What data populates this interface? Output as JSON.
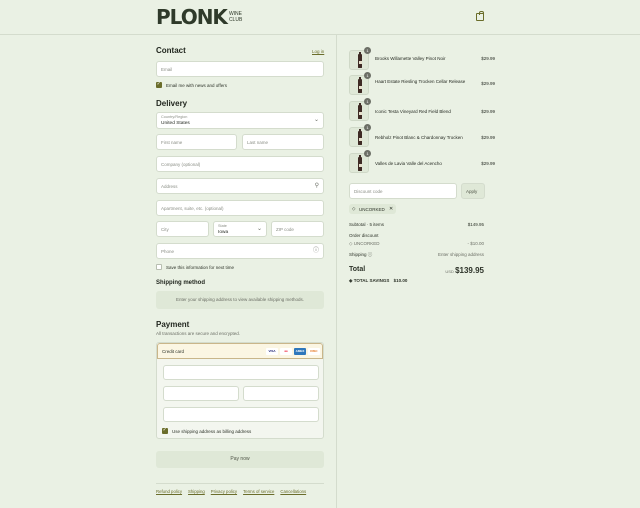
{
  "header": {
    "logo_main": "PLONK",
    "logo_sub": "WINE CLUB"
  },
  "contact": {
    "title": "Contact",
    "login": "Log in",
    "email_placeholder": "Email",
    "newsletter": "Email me with news and offers"
  },
  "delivery": {
    "title": "Delivery",
    "country_label": "Country/Region",
    "country_value": "United States",
    "first_name": "First name",
    "last_name": "Last name",
    "company": "Company (optional)",
    "address": "Address",
    "apartment": "Apartment, suite, etc. (optional)",
    "city": "City",
    "state_label": "State",
    "state_value": "Iowa",
    "zip": "ZIP code",
    "phone": "Phone",
    "save_info": "Save this information for next time"
  },
  "shipping_method": {
    "title": "Shipping method",
    "message": "Enter your shipping address to view available shipping methods."
  },
  "payment": {
    "title": "Payment",
    "subtitle": "All transactions are secure and encrypted.",
    "method": "Credit card",
    "card_logos": [
      "VISA",
      "MC",
      "AMEX",
      "DISCOVER"
    ],
    "billing_same": "Use shipping address as billing address",
    "pay_button": "Pay now"
  },
  "footer": {
    "links": [
      "Refund policy",
      "Shipping",
      "Privacy policy",
      "Terms of service",
      "Cancellations"
    ]
  },
  "order": {
    "items": [
      {
        "name": "Brooks Willamette Valley Pinot Noir",
        "qty": "1",
        "price": "$29.99"
      },
      {
        "name": "Haart Estate Riesling Trocken Cellar Release",
        "qty": "1",
        "price": "$29.99"
      },
      {
        "name": "Iconic Testa Vineyard Red Field Blend",
        "qty": "1",
        "price": "$29.99"
      },
      {
        "name": "Rebholz Pinot Blanc & Chardonnay Trocken",
        "qty": "1",
        "price": "$29.99"
      },
      {
        "name": "Valles de Lavia Valle del Acencho",
        "qty": "1",
        "price": "$29.99"
      }
    ],
    "discount_placeholder": "Discount code",
    "apply": "Apply",
    "applied_code": "UNCORKED",
    "subtotal_label": "Subtotal · 5 items",
    "subtotal": "$149.95",
    "order_discount_label": "Order discount",
    "discount_code": "UNCORKED",
    "discount_amount": "- $10.00",
    "shipping_label": "Shipping",
    "shipping_value": "Enter shipping address",
    "total_label": "Total",
    "currency": "USD",
    "total": "$139.95",
    "savings_label": "TOTAL SAVINGS",
    "savings": "$10.00"
  }
}
